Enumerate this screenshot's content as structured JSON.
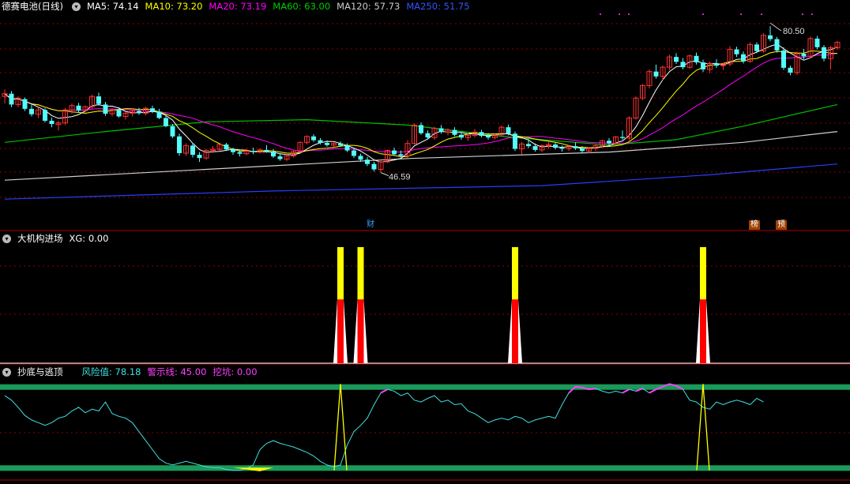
{
  "main": {
    "stock_title": "德赛电池(日线)",
    "ma_labels": [
      {
        "text": "MA5: 74.14",
        "color": "#ffffff"
      },
      {
        "text": "MA10: 73.20",
        "color": "#ffff00"
      },
      {
        "text": "MA20: 73.19",
        "color": "#ff00ff"
      },
      {
        "text": "MA60: 63.00",
        "color": "#00cc00"
      },
      {
        "text": "MA120: 57.73",
        "color": "#cccccc"
      },
      {
        "text": "MA250: 51.75",
        "color": "#3355ff"
      }
    ],
    "high_label": "80.50",
    "low_label": "46.59",
    "badge_cai": "财",
    "badge_bang": "榜",
    "badge_yu": "预"
  },
  "panel2": {
    "title": "大机构进场",
    "xg_label": "XG: 0.00"
  },
  "panel3": {
    "title": "抄底与逃顶",
    "risk_label": "风险值: 78.18",
    "warn_label": "警示线: 45.00",
    "dig_label": "挖坑: 0.00"
  },
  "colors": {
    "up": "#ff3232",
    "down": "#54fcfc",
    "grid": "#8b0000",
    "bg": "#000000"
  },
  "chart_data": [
    {
      "type": "candlestick",
      "title": "德赛电池(日线)",
      "y_range": [
        44,
        83
      ],
      "candles": [
        [
          67.5,
          68.8,
          66.2,
          68.0
        ],
        [
          68,
          68.5,
          65.5,
          66.0
        ],
        [
          66,
          67.5,
          65.5,
          67.2
        ],
        [
          67,
          67.3,
          64.8,
          65.2
        ],
        [
          65.2,
          66,
          63.8,
          64.2
        ],
        [
          64.2,
          65.5,
          63.5,
          65.0
        ],
        [
          65,
          65.3,
          62.7,
          63.0
        ],
        [
          63,
          63.6,
          61.8,
          62.4
        ],
        [
          62.3,
          63,
          61.2,
          62.6
        ],
        [
          62.6,
          65.4,
          62.2,
          65.0
        ],
        [
          65,
          66.2,
          64.3,
          65.8
        ],
        [
          65.8,
          66.3,
          64.6,
          64.9
        ],
        [
          64.9,
          65.8,
          64.5,
          65.6
        ],
        [
          65.6,
          67.8,
          65.2,
          67.5
        ],
        [
          67.5,
          68.2,
          65.8,
          66.1
        ],
        [
          66,
          66.5,
          63.9,
          64.3
        ],
        [
          64.3,
          65.3,
          63.8,
          65.0
        ],
        [
          65,
          65.5,
          63.6,
          63.8
        ],
        [
          63.8,
          64.6,
          63.2,
          64.4
        ],
        [
          64.4,
          65.3,
          63.8,
          64.8
        ],
        [
          64.8,
          65.4,
          64.1,
          64.4
        ],
        [
          64.4,
          65.6,
          64,
          65.3
        ],
        [
          65.3,
          65.8,
          64.4,
          64.7
        ],
        [
          64.7,
          65.2,
          63.3,
          63.5
        ],
        [
          63.5,
          64,
          61.8,
          62
        ],
        [
          62,
          62.4,
          59.8,
          60.1
        ],
        [
          60.1,
          60.6,
          56.5,
          57
        ],
        [
          57,
          58.8,
          56.5,
          58.4
        ],
        [
          58.4,
          58.9,
          56.2,
          56.7
        ],
        [
          56.7,
          57.2,
          55.4,
          56.1
        ],
        [
          56.1,
          57.8,
          55.8,
          57.5
        ],
        [
          57.5,
          58.3,
          57,
          57.7
        ],
        [
          57.7,
          58.7,
          57.4,
          58.6
        ],
        [
          58.6,
          58.9,
          57.4,
          57.7
        ],
        [
          57.7,
          58,
          56.7,
          57.2
        ],
        [
          57.2,
          57.6,
          56.4,
          56.9
        ],
        [
          56.9,
          57.8,
          56.6,
          57.4
        ],
        [
          57.4,
          58,
          56.8,
          57.2
        ],
        [
          57.2,
          57.9,
          56.9,
          57.6
        ],
        [
          57.6,
          58.5,
          57.1,
          57.3
        ],
        [
          57.3,
          57.8,
          56.1,
          56.4
        ],
        [
          56.4,
          57,
          55.6,
          55.9
        ],
        [
          55.9,
          56.8,
          55.5,
          56.5
        ],
        [
          56.5,
          57.6,
          56.2,
          57.3
        ],
        [
          57.3,
          59.2,
          57,
          59
        ],
        [
          59,
          60.3,
          58.6,
          60.1
        ],
        [
          60.1,
          60.5,
          59.1,
          59.4
        ],
        [
          59.4,
          59.8,
          58.6,
          58.9
        ],
        [
          58.9,
          59.4,
          58.2,
          58.5
        ],
        [
          58.5,
          59,
          57.9,
          58.8
        ],
        [
          58.8,
          59.2,
          58.2,
          58.4
        ],
        [
          58.4,
          58.8,
          57.2,
          57.5
        ],
        [
          57.5,
          57.9,
          56.1,
          56.5
        ],
        [
          56.5,
          56.9,
          55.4,
          55.8
        ],
        [
          55.8,
          56.3,
          54.6,
          55
        ],
        [
          55,
          55.4,
          53.6,
          54
        ],
        [
          54,
          55.6,
          53.4,
          55.4
        ],
        [
          55.4,
          57.7,
          55.2,
          57.5
        ],
        [
          57.5,
          58,
          56.6,
          56.8
        ],
        [
          56.8,
          57.5,
          56.2,
          56.5
        ],
        [
          56.5,
          59.4,
          56.1,
          58.8
        ],
        [
          58.8,
          62.5,
          58.6,
          62.2
        ],
        [
          62.2,
          62.7,
          60.4,
          60.7
        ],
        [
          60.7,
          61.2,
          59.6,
          59.9
        ],
        [
          59.9,
          61.9,
          59.5,
          61.6
        ],
        [
          61.6,
          62.2,
          60.6,
          60.9
        ],
        [
          60.9,
          61.6,
          60.3,
          61.3
        ],
        [
          61.3,
          61.8,
          60.1,
          60.4
        ],
        [
          60.4,
          60.9,
          59.5,
          59.9
        ],
        [
          59.9,
          60.6,
          59.3,
          60.3
        ],
        [
          60.3,
          61.5,
          59.9,
          60.9
        ],
        [
          60.9,
          61.3,
          59.9,
          60.2
        ],
        [
          60.2,
          60.7,
          59.5,
          59.9
        ],
        [
          59.9,
          60.6,
          59.6,
          60.4
        ],
        [
          60.4,
          62.1,
          60.1,
          61.8
        ],
        [
          61.8,
          62.3,
          60.3,
          60.6
        ],
        [
          60.6,
          61,
          57.4,
          57.8
        ],
        [
          57.8,
          59.1,
          56.8,
          58.7
        ],
        [
          58.7,
          59.6,
          57.9,
          58.3
        ],
        [
          58.3,
          58.8,
          57.3,
          57.6
        ],
        [
          57.6,
          58.6,
          57.2,
          58.4
        ],
        [
          58.4,
          59.2,
          57.8,
          58.6
        ],
        [
          58.6,
          59,
          57.7,
          58
        ],
        [
          58,
          58.4,
          57.3,
          57.8
        ],
        [
          57.8,
          58.5,
          57.4,
          58.3
        ],
        [
          58.3,
          59,
          57.6,
          57.9
        ],
        [
          57.9,
          58.3,
          57,
          57.4
        ],
        [
          57.4,
          58.1,
          57,
          57.9
        ],
        [
          57.9,
          58.6,
          57.4,
          58.4
        ],
        [
          58.4,
          59.5,
          58,
          59.3
        ],
        [
          59.3,
          59.8,
          58.4,
          58.8
        ],
        [
          58.8,
          60.2,
          58.5,
          60
        ],
        [
          60,
          61.2,
          59.5,
          59.8
        ],
        [
          59.8,
          63.8,
          59.4,
          63.5
        ],
        [
          63.5,
          67.5,
          63.2,
          67.2
        ],
        [
          67.2,
          69.8,
          66.8,
          69.5
        ],
        [
          69.5,
          72.5,
          69,
          72.1
        ],
        [
          72.1,
          73.4,
          70.8,
          71.2
        ],
        [
          71.2,
          73.2,
          70.5,
          72.9
        ],
        [
          72.9,
          75.2,
          72.4,
          74.8
        ],
        [
          74.8,
          75.5,
          73.5,
          73.9
        ],
        [
          73.9,
          74.6,
          72.5,
          72.9
        ],
        [
          72.9,
          75.3,
          72.6,
          75
        ],
        [
          75,
          75.6,
          73.4,
          73.8
        ],
        [
          73.8,
          74.3,
          72,
          72.5
        ],
        [
          72.5,
          73.9,
          71.8,
          73.6
        ],
        [
          73.6,
          74.4,
          72.8,
          73.2
        ],
        [
          73.2,
          73.7,
          72.4,
          73.5
        ],
        [
          73.5,
          76.8,
          73.1,
          76.2
        ],
        [
          76.2,
          76.7,
          74.8,
          75.3
        ],
        [
          75.3,
          75.8,
          73.6,
          74
        ],
        [
          74,
          77.5,
          73.7,
          77.1
        ],
        [
          77.1,
          77.5,
          75.5,
          75.9
        ],
        [
          75.9,
          79.2,
          75.6,
          78.8
        ],
        [
          78.8,
          80.5,
          77.7,
          78.1
        ],
        [
          78.1,
          78.5,
          75.6,
          76
        ],
        [
          76,
          76.6,
          72.4,
          72.8
        ],
        [
          72.8,
          73.2,
          71.4,
          71.9
        ],
        [
          71.9,
          75.8,
          71.5,
          75.4
        ],
        [
          75.4,
          76.3,
          74.4,
          74.9
        ],
        [
          74.9,
          78.6,
          74.6,
          78.2
        ],
        [
          78.2,
          78.7,
          76.2,
          76.6
        ],
        [
          76.6,
          77,
          74,
          74.5
        ],
        [
          74.5,
          76.8,
          72.5,
          76.5
        ],
        [
          76.5,
          77.8,
          76.1,
          77.5
        ]
      ],
      "moving_averages": [
        {
          "name": "MA5",
          "value": 74.14,
          "color": "#ffffff"
        },
        {
          "name": "MA10",
          "value": 73.2,
          "color": "#ffff00"
        },
        {
          "name": "MA20",
          "value": 73.19,
          "color": "#ff00ff"
        },
        {
          "name": "MA60",
          "value": 63.0,
          "color": "#00cc00"
        },
        {
          "name": "MA120",
          "value": 57.73,
          "color": "#cccccc"
        },
        {
          "name": "MA250",
          "value": 51.75,
          "color": "#3355ff"
        }
      ],
      "ma60_trend": [
        [
          0,
          59
        ],
        [
          15,
          61
        ],
        [
          30,
          62.8
        ],
        [
          45,
          63.2
        ],
        [
          60,
          62.2
        ],
        [
          75,
          60
        ],
        [
          90,
          58.5
        ],
        [
          100,
          59.5
        ],
        [
          110,
          62
        ],
        [
          124,
          66
        ]
      ],
      "ma120_trend": [
        [
          0,
          52
        ],
        [
          30,
          54
        ],
        [
          60,
          56
        ],
        [
          90,
          57.2
        ],
        [
          110,
          59
        ],
        [
          124,
          61
        ]
      ],
      "ma250_trend": [
        [
          0,
          48.5
        ],
        [
          40,
          50
        ],
        [
          80,
          51
        ],
        [
          105,
          53
        ],
        [
          124,
          55
        ]
      ],
      "high": 80.5,
      "low": 46.59
    },
    {
      "type": "bar",
      "title": "大机构进场",
      "series": [
        {
          "name": "XG",
          "value": 0.0
        }
      ],
      "signal_bars": [
        {
          "index": 50,
          "top": 1,
          "mid": 0.55
        },
        {
          "index": 53,
          "top": 1,
          "mid": 0.55
        },
        {
          "index": 76,
          "top": 1,
          "mid": 0.55
        },
        {
          "index": 104,
          "top": 1,
          "mid": 0.55
        }
      ]
    },
    {
      "type": "line",
      "title": "抄底与逃顶",
      "ylim": [
        0,
        100
      ],
      "bands": [
        95,
        5
      ],
      "series": [
        {
          "name": "风险值",
          "value": 78.18,
          "values": [
            85,
            80,
            72,
            63,
            58,
            55,
            52,
            55,
            60,
            62,
            68,
            72,
            66,
            70,
            68,
            78,
            65,
            62,
            60,
            55,
            45,
            35,
            25,
            15,
            10,
            8,
            10,
            12,
            10,
            8,
            6,
            5,
            5,
            3,
            2,
            2,
            4,
            8,
            25,
            32,
            35,
            32,
            30,
            28,
            25,
            22,
            18,
            12,
            8,
            6,
            8,
            30,
            45,
            52,
            60,
            75,
            88,
            92,
            90,
            85,
            88,
            80,
            78,
            82,
            85,
            78,
            80,
            75,
            76,
            68,
            65,
            60,
            55,
            58,
            60,
            58,
            62,
            60,
            55,
            58,
            60,
            62,
            60,
            75,
            88,
            95,
            94,
            92,
            93,
            90,
            88,
            90,
            88,
            92,
            90,
            93,
            88,
            92,
            95,
            98,
            96,
            92,
            80,
            78,
            72,
            70,
            78,
            75,
            78,
            80,
            78,
            75,
            82,
            78
          ],
          "color": "#40e0e0"
        },
        {
          "name": "警示线",
          "value": 45.0
        },
        {
          "name": "挖坑",
          "value": 0.0
        }
      ]
    }
  ]
}
